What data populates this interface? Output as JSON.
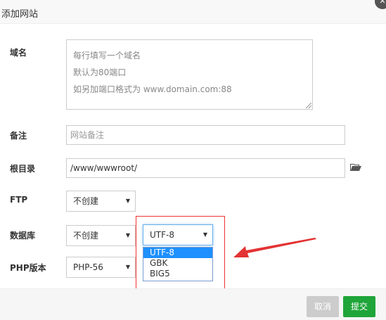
{
  "dialog": {
    "title": "添加网站",
    "close_icon": "close-icon"
  },
  "form": {
    "domain": {
      "label": "域名",
      "placeholder_lines": [
        "每行填写一个域名",
        "默认为80端口",
        "如另加端口格式为 www.domain.com:88"
      ]
    },
    "note": {
      "label": "备注",
      "placeholder": "网站备注"
    },
    "root_dir": {
      "label": "根目录",
      "value": "/www/wwwroot/",
      "icon": "folder-icon"
    },
    "ftp": {
      "label": "FTP",
      "selected": "不创建"
    },
    "database": {
      "label": "数据库",
      "selected": "不创建",
      "charset": {
        "selected": "UTF-8",
        "options": [
          "UTF-8",
          "GBK",
          "BIG5"
        ],
        "highlighted": "UTF-8"
      }
    },
    "php_version": {
      "label": "PHP版本",
      "selected": "PHP-56"
    }
  },
  "footer": {
    "cancel_label": "取消",
    "submit_label": "提交"
  },
  "colors": {
    "submit": "#20a53a",
    "cancel": "#cccccc",
    "highlight": "#1e90ff",
    "annotation": "#e33333"
  }
}
